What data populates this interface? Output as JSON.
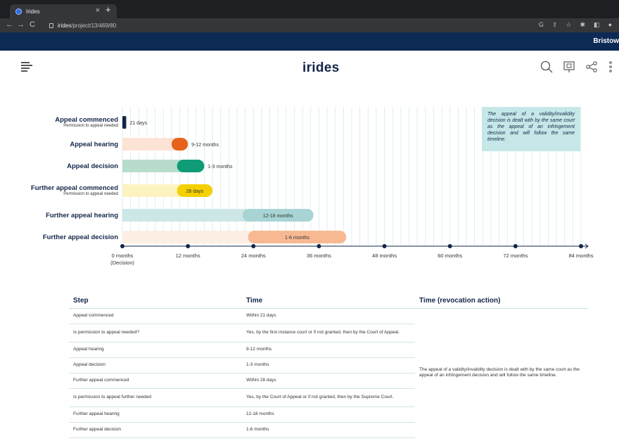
{
  "browser": {
    "tab_title": "Irides",
    "tab_close": "×",
    "new_tab": "+",
    "url_host": "irides",
    "url_path": "/project/13/469/80",
    "nav_back": "←",
    "nav_forward": "→",
    "nav_reload": "C"
  },
  "brandbar": {
    "right_text": "Bristow"
  },
  "app": {
    "logo": "irides"
  },
  "timeline": {
    "rows": [
      {
        "label": "Appeal commenced",
        "sublabel": "Permission to appeal needed",
        "bar_label": "21 days",
        "track_end": 0,
        "pill_start": 0,
        "pill_end": 0.7,
        "color": "#12264a",
        "track_color": "#ffffff",
        "label_outside": true
      },
      {
        "label": "Appeal hearing",
        "sublabel": "",
        "bar_label": "9-12 months",
        "track_end": 9,
        "pill_start": 9,
        "pill_end": 12,
        "color": "#e8621c",
        "track_color": "#fde3d6",
        "label_outside": true
      },
      {
        "label": "Appeal decision",
        "sublabel": "",
        "bar_label": "1-3 months",
        "track_end": 10,
        "pill_start": 10,
        "pill_end": 15,
        "color": "#0f9b76",
        "track_color": "#b8dccc",
        "label_outside": true
      },
      {
        "label": "Further appeal commenced",
        "sublabel": "Permission to appeal needed",
        "bar_label": "28 days",
        "track_end": 10,
        "pill_start": 10,
        "pill_end": 16.5,
        "color": "#f5d000",
        "track_color": "#fdf3c0",
        "label_outside": false
      },
      {
        "label": "Further appeal hearing",
        "sublabel": "",
        "bar_label": "12-18 months",
        "track_end": 22,
        "pill_start": 22,
        "pill_end": 35,
        "color": "#a8d4d4",
        "track_color": "#cde6e6",
        "label_outside": false
      },
      {
        "label": "Further appeal decision",
        "sublabel": "",
        "bar_label": "1-6 months",
        "track_end": 23,
        "pill_start": 23,
        "pill_end": 41,
        "color": "#f8b992",
        "track_color": "#fdeee4",
        "label_outside": false
      }
    ],
    "ticks": [
      {
        "value": 0,
        "label": "0 months",
        "sub": "(Decision)"
      },
      {
        "value": 12,
        "label": "12 months",
        "sub": ""
      },
      {
        "value": 24,
        "label": "24 months",
        "sub": ""
      },
      {
        "value": 36,
        "label": "36 months",
        "sub": ""
      },
      {
        "value": 48,
        "label": "48 months",
        "sub": ""
      },
      {
        "value": 60,
        "label": "60 months",
        "sub": ""
      },
      {
        "value": 72,
        "label": "72 months",
        "sub": ""
      },
      {
        "value": 84,
        "label": "84 months",
        "sub": ""
      }
    ],
    "axis_max": 84,
    "note": "The appeal of a validity/invalidity decision is dealt with by the same court as the appeal of an infringement decision and will follow the same timeline."
  },
  "table": {
    "headers": [
      "Step",
      "Time",
      "Time (revocation action)"
    ],
    "rows": [
      [
        "Appeal commenced",
        "Within 21 days"
      ],
      [
        "Is permission to appeal needed?",
        "Yes, by the first instance court or if not granted, then by the Court of Appeal."
      ],
      [
        "Appeal hearing",
        "9-12 months"
      ],
      [
        "Appeal decision",
        "1-3 months"
      ],
      [
        "Further appeal commenced",
        "Within 28 days"
      ],
      [
        "Is permission to appeal further needed",
        "Yes, by the Court of Appeal or if not granted, then by the Supreme Court."
      ],
      [
        "Further appeal hearing",
        "12-18 months"
      ],
      [
        "Further appeal decision",
        "1-6 months"
      ]
    ],
    "revocation_note": "The appeal of a validity/invalidity decision is dealt with by the same court as the appeal of an infringement decision and will follow the same timeline."
  }
}
